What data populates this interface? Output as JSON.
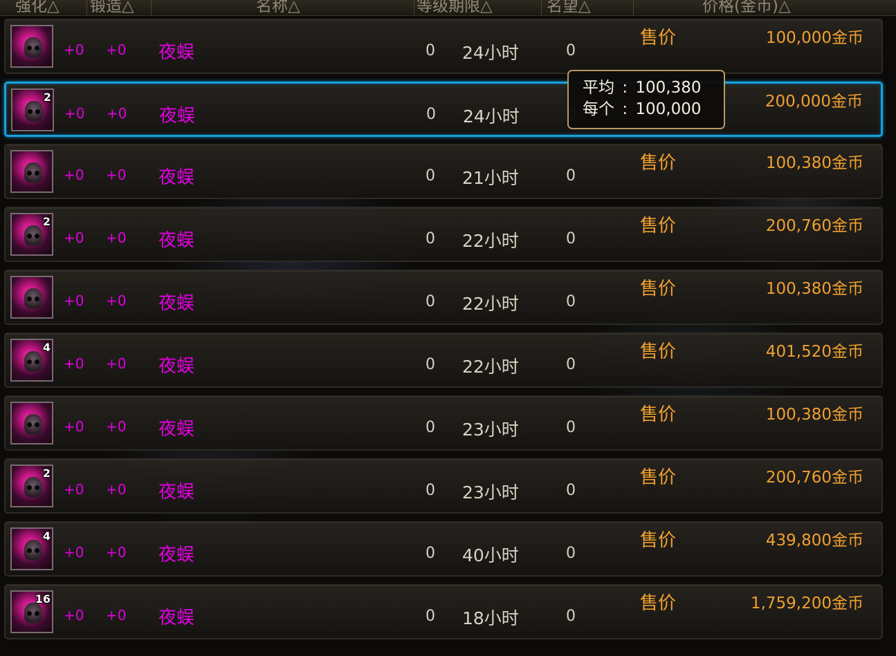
{
  "header": {
    "columns": [
      "强化△",
      "锻造△",
      "名称△",
      "等级期限△",
      "名望△",
      "价格(金币)△"
    ]
  },
  "sell_label": "售价",
  "rows": [
    {
      "quantity": "",
      "enhance": "+0",
      "forge": "+0",
      "name": "夜蜈",
      "level": "0",
      "duration": "24小时",
      "reputation": "0",
      "sell_label": "售价",
      "price": "100,000金币"
    },
    {
      "quantity": "2",
      "enhance": "+0",
      "forge": "+0",
      "name": "夜蜈",
      "level": "0",
      "duration": "24小时",
      "reputation": "0",
      "sell_label": "",
      "price": "200,000金币"
    },
    {
      "quantity": "",
      "enhance": "+0",
      "forge": "+0",
      "name": "夜蜈",
      "level": "0",
      "duration": "21小时",
      "reputation": "0",
      "sell_label": "售价",
      "price": "100,380金币"
    },
    {
      "quantity": "2",
      "enhance": "+0",
      "forge": "+0",
      "name": "夜蜈",
      "level": "0",
      "duration": "22小时",
      "reputation": "0",
      "sell_label": "售价",
      "price": "200,760金币"
    },
    {
      "quantity": "",
      "enhance": "+0",
      "forge": "+0",
      "name": "夜蜈",
      "level": "0",
      "duration": "22小时",
      "reputation": "0",
      "sell_label": "售价",
      "price": "100,380金币"
    },
    {
      "quantity": "4",
      "enhance": "+0",
      "forge": "+0",
      "name": "夜蜈",
      "level": "0",
      "duration": "22小时",
      "reputation": "0",
      "sell_label": "售价",
      "price": "401,520金币"
    },
    {
      "quantity": "",
      "enhance": "+0",
      "forge": "+0",
      "name": "夜蜈",
      "level": "0",
      "duration": "23小时",
      "reputation": "0",
      "sell_label": "售价",
      "price": "100,380金币"
    },
    {
      "quantity": "2",
      "enhance": "+0",
      "forge": "+0",
      "name": "夜蜈",
      "level": "0",
      "duration": "23小时",
      "reputation": "0",
      "sell_label": "售价",
      "price": "200,760金币"
    },
    {
      "quantity": "4",
      "enhance": "+0",
      "forge": "+0",
      "name": "夜蜈",
      "level": "0",
      "duration": "40小时",
      "reputation": "0",
      "sell_label": "售价",
      "price": "439,800金币"
    },
    {
      "quantity": "16",
      "enhance": "+0",
      "forge": "+0",
      "name": "夜蜈",
      "level": "0",
      "duration": "18小时",
      "reputation": "0",
      "sell_label": "售价",
      "price": "1,759,200金币"
    }
  ],
  "selected_row": 1,
  "tooltip": {
    "average_label": "平均",
    "average_value": "100,380",
    "each_label": "每个",
    "each_value": "100,000",
    "separator": ":"
  },
  "colors": {
    "item_name": "#e000e0",
    "price": "#f0a030",
    "selection": "#1aa0d8",
    "tooltip_border": "#b79a62"
  }
}
